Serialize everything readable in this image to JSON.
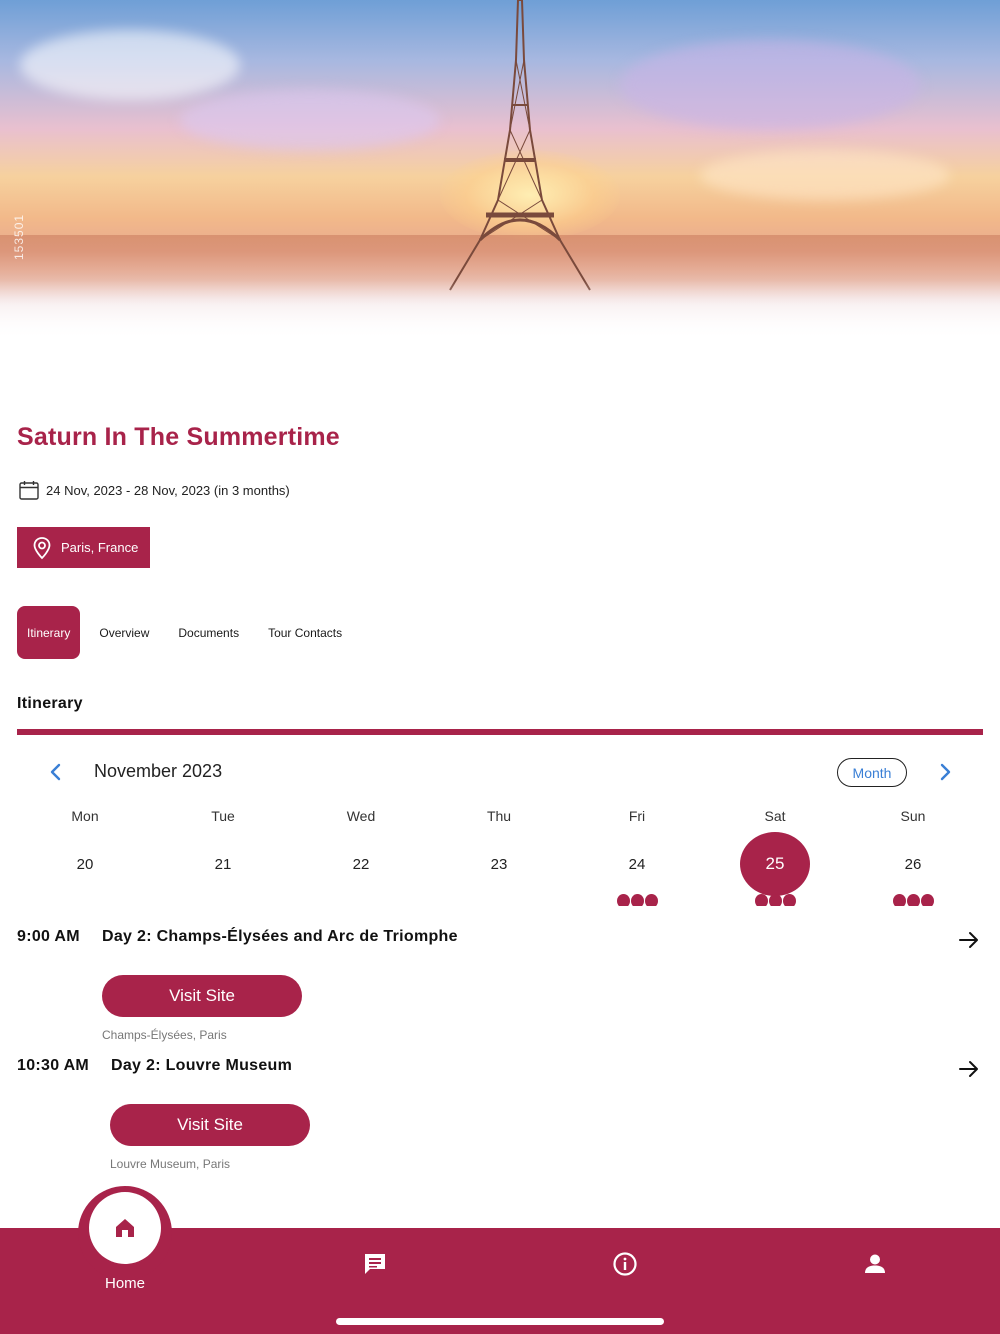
{
  "hero": {
    "watermark": "153501"
  },
  "trip": {
    "title": "Saturn In The Summertime",
    "dates": "24 Nov, 2023 - 28 Nov, 2023 (in 3 months)",
    "location": "Paris, France"
  },
  "tabs": [
    {
      "label": "Itinerary",
      "active": true
    },
    {
      "label": "Overview",
      "active": false
    },
    {
      "label": "Documents",
      "active": false
    },
    {
      "label": "Tour Contacts",
      "active": false
    }
  ],
  "section": {
    "title": "Itinerary"
  },
  "calendar": {
    "month_label": "November 2023",
    "mode_label": "Month",
    "weekdays": [
      "Mon",
      "Tue",
      "Wed",
      "Thu",
      "Fri",
      "Sat",
      "Sun"
    ],
    "days": [
      "20",
      "21",
      "22",
      "23",
      "24",
      "25",
      "26"
    ],
    "selected_day": "25",
    "days_with_events": [
      "24",
      "25",
      "26"
    ]
  },
  "events": [
    {
      "time": "9:00 AM",
      "title": "Day 2: Champs-Élysées and Arc de Triomphe",
      "button": "Visit Site",
      "address": "Champs-Élysées, Paris"
    },
    {
      "time": "10:30 AM",
      "title": "Day 2: Louvre Museum",
      "button": "Visit Site",
      "address": "Louvre Museum, Paris"
    }
  ],
  "nav": {
    "home_label": "Home"
  },
  "colors": {
    "accent": "#a8234a",
    "link": "#3a7fd5"
  }
}
